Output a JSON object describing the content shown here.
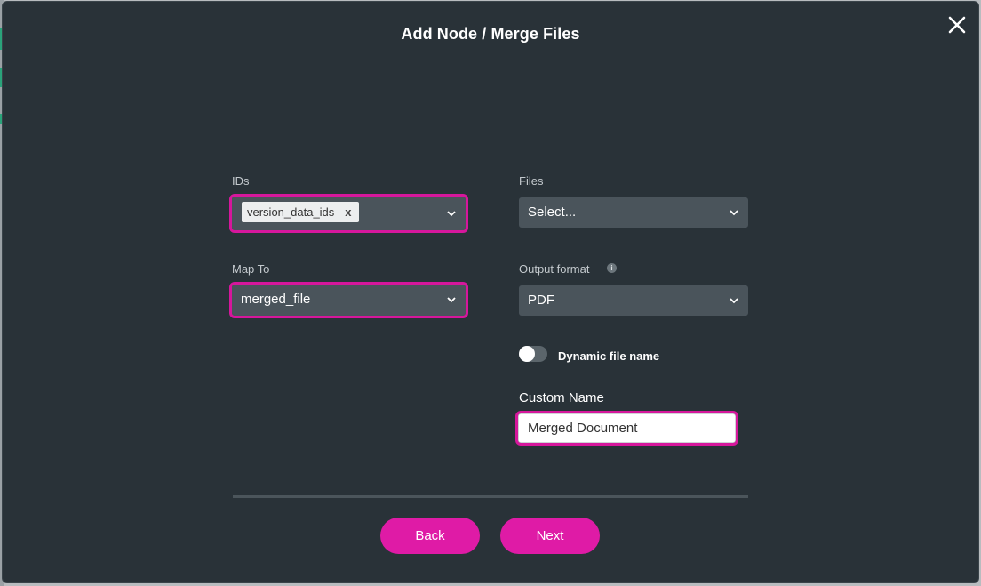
{
  "dialog": {
    "title": "Add Node / Merge Files"
  },
  "fields": {
    "ids": {
      "label": "IDs",
      "chip": "version_data_ids",
      "chip_remove": "x"
    },
    "files": {
      "label": "Files",
      "value": "Select..."
    },
    "map_to": {
      "label": "Map To",
      "value": "merged_file"
    },
    "output_format": {
      "label": "Output format",
      "info": "i",
      "value": "PDF"
    },
    "dynamic_file_name": {
      "label": "Dynamic file name",
      "enabled": false
    },
    "custom_name": {
      "label": "Custom Name",
      "value": "Merged Document"
    }
  },
  "footer": {
    "back_label": "Back",
    "next_label": "Next"
  },
  "colors": {
    "accent": "#df1ba6",
    "highlight": "#d6179c",
    "modal_bg": "#293238",
    "select_bg": "#4a545b"
  },
  "icons": {
    "close": "close-icon",
    "chevron": "chevron-down-icon",
    "info": "info-icon"
  }
}
